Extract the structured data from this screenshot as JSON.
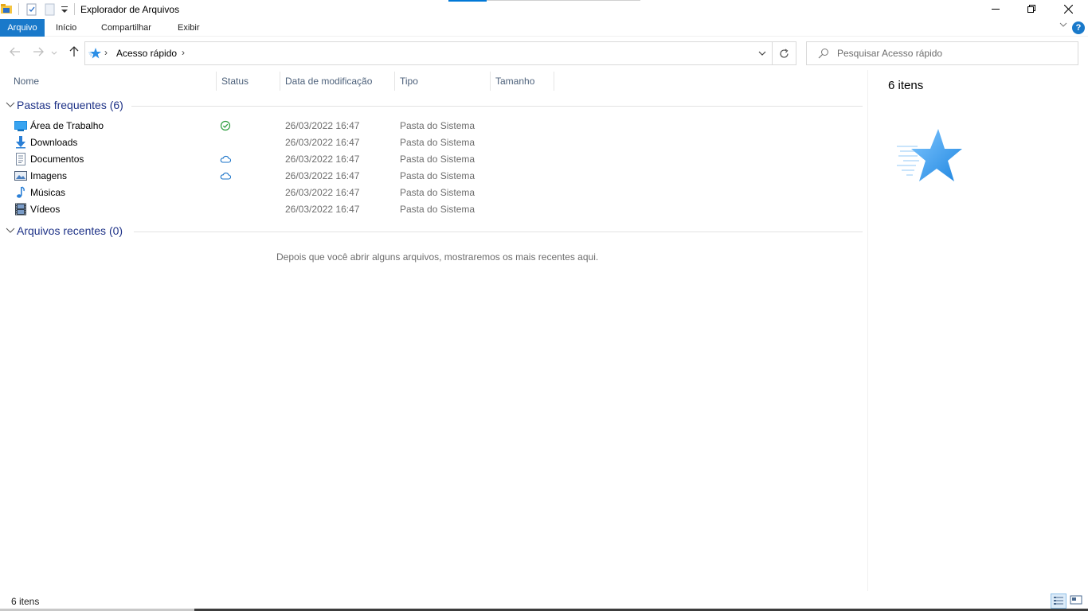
{
  "window": {
    "title": "Explorador de Arquivos"
  },
  "ribbon": {
    "tabs": [
      "Arquivo",
      "Início",
      "Compartilhar",
      "Exibir"
    ],
    "help_label": "?"
  },
  "address": {
    "location": "Acesso rápido"
  },
  "search": {
    "placeholder": "Pesquisar Acesso rápido"
  },
  "columns": [
    "Nome",
    "Status",
    "Data de modificação",
    "Tipo",
    "Tamanho"
  ],
  "groups": {
    "frequent": {
      "title": "Pastas frequentes (6)",
      "items": [
        {
          "name": "Área de Trabalho",
          "icon": "desktop-folder-icon",
          "status": "synced-check-icon",
          "date": "26/03/2022 16:47",
          "type": "Pasta do Sistema"
        },
        {
          "name": "Downloads",
          "icon": "downloads-folder-icon",
          "status": "",
          "date": "26/03/2022 16:47",
          "type": "Pasta do Sistema"
        },
        {
          "name": "Documentos",
          "icon": "documents-folder-icon",
          "status": "cloud-icon",
          "date": "26/03/2022 16:47",
          "type": "Pasta do Sistema"
        },
        {
          "name": "Imagens",
          "icon": "pictures-folder-icon",
          "status": "cloud-icon",
          "date": "26/03/2022 16:47",
          "type": "Pasta do Sistema"
        },
        {
          "name": "Músicas",
          "icon": "music-folder-icon",
          "status": "",
          "date": "26/03/2022 16:47",
          "type": "Pasta do Sistema"
        },
        {
          "name": "Vídeos",
          "icon": "videos-folder-icon",
          "status": "",
          "date": "26/03/2022 16:47",
          "type": "Pasta do Sistema"
        }
      ]
    },
    "recent": {
      "title": "Arquivos recentes (0)",
      "empty_message": "Depois que você abrir alguns arquivos, mostraremos os mais recentes aqui."
    }
  },
  "details": {
    "count": "6 itens"
  },
  "statusbar": {
    "count": "6 itens"
  },
  "colors": {
    "accent": "#1979ca",
    "group_title": "#1e3287",
    "column_header": "#4c607a",
    "secondary_text": "#6d6d6d"
  }
}
